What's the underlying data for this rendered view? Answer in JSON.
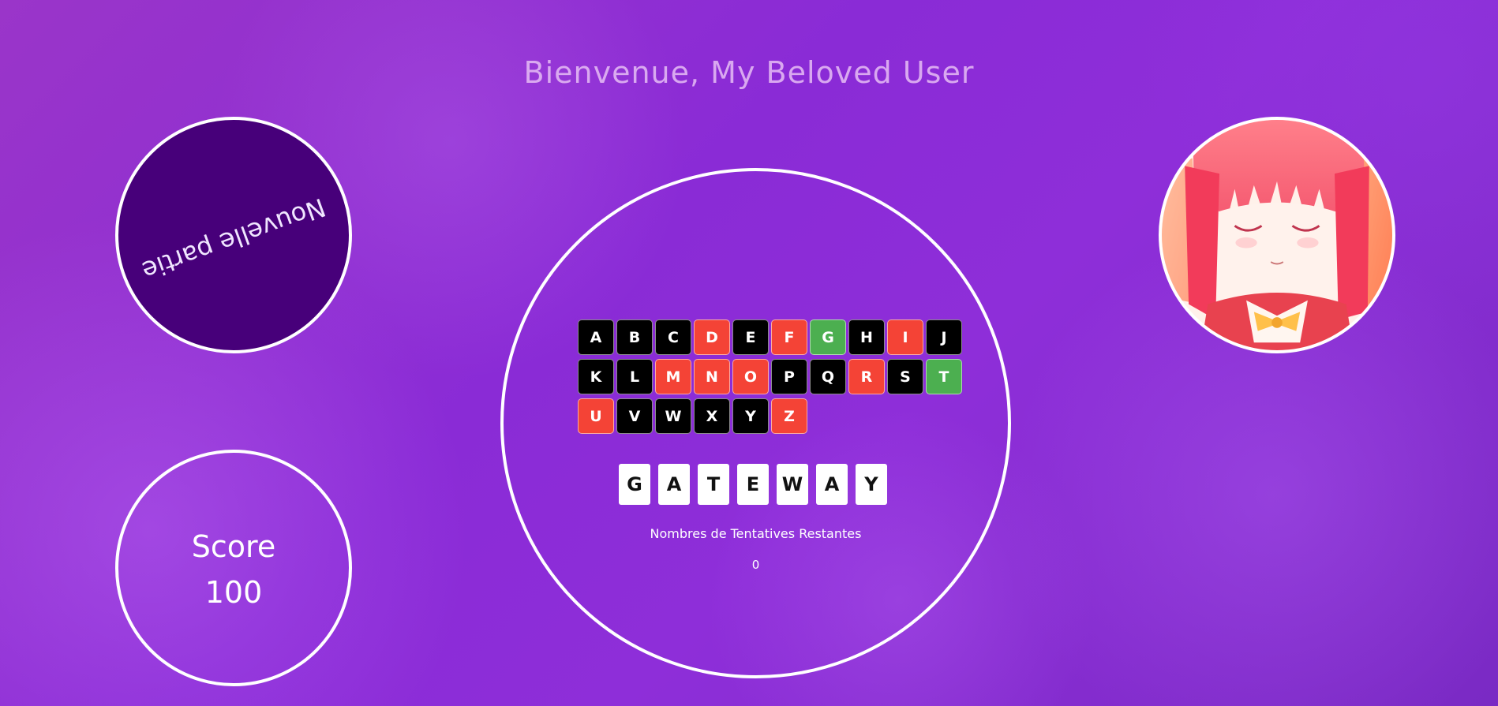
{
  "header": {
    "title": "Bienvenue, My Beloved User"
  },
  "new_game": {
    "label": "Nouvelle partie"
  },
  "score": {
    "label": "Score",
    "value": "100"
  },
  "avatar": {
    "icon": "anime-girl-avatar"
  },
  "keyboard": {
    "rows": [
      [
        {
          "letter": "A",
          "state": "unused"
        },
        {
          "letter": "B",
          "state": "unused"
        },
        {
          "letter": "C",
          "state": "unused"
        },
        {
          "letter": "D",
          "state": "wrong"
        },
        {
          "letter": "E",
          "state": "unused"
        },
        {
          "letter": "F",
          "state": "wrong"
        },
        {
          "letter": "G",
          "state": "right"
        },
        {
          "letter": "H",
          "state": "unused"
        },
        {
          "letter": "I",
          "state": "wrong"
        },
        {
          "letter": "J",
          "state": "unused"
        }
      ],
      [
        {
          "letter": "K",
          "state": "unused"
        },
        {
          "letter": "L",
          "state": "unused"
        },
        {
          "letter": "M",
          "state": "wrong"
        },
        {
          "letter": "N",
          "state": "wrong"
        },
        {
          "letter": "O",
          "state": "wrong"
        },
        {
          "letter": "P",
          "state": "unused"
        },
        {
          "letter": "Q",
          "state": "unused"
        },
        {
          "letter": "R",
          "state": "wrong"
        },
        {
          "letter": "S",
          "state": "unused"
        },
        {
          "letter": "T",
          "state": "right"
        }
      ],
      [
        {
          "letter": "U",
          "state": "wrong"
        },
        {
          "letter": "V",
          "state": "unused"
        },
        {
          "letter": "W",
          "state": "unused"
        },
        {
          "letter": "X",
          "state": "unused"
        },
        {
          "letter": "Y",
          "state": "unused"
        },
        {
          "letter": "Z",
          "state": "wrong"
        }
      ]
    ]
  },
  "word": {
    "letters": [
      "G",
      "A",
      "T",
      "E",
      "W",
      "A",
      "Y"
    ]
  },
  "attempts": {
    "label": "Nombres de Tentatives Restantes",
    "value": "0"
  },
  "colors": {
    "wrong": "#f44336",
    "right": "#4caf50",
    "unused": "#000000",
    "new_game_bg": "#47007a"
  }
}
